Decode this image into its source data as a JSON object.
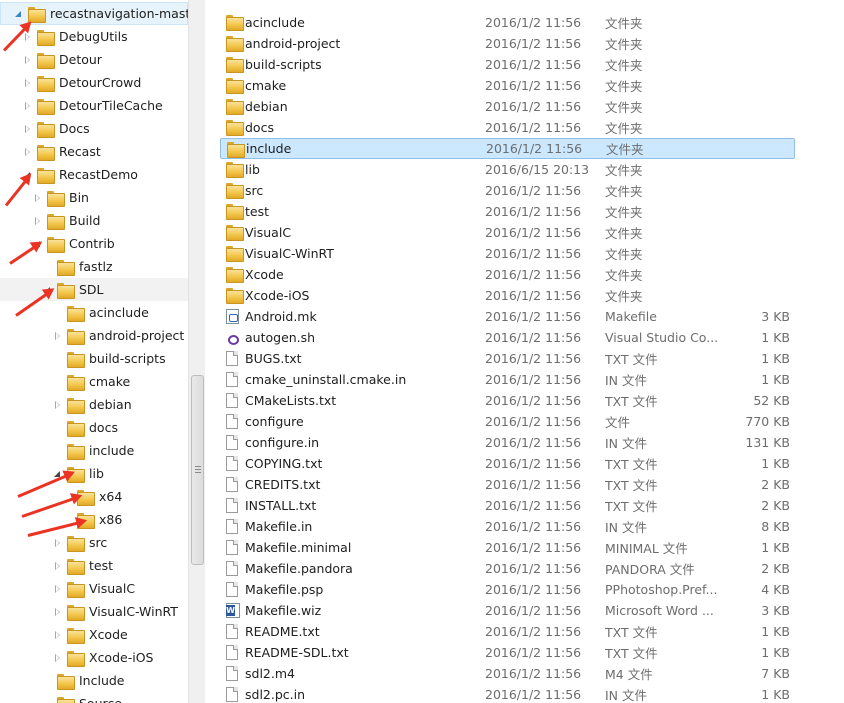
{
  "tree": {
    "items": [
      {
        "label": "recastnavigation-master",
        "depth": 0,
        "state": "expanded-light",
        "selected": true
      },
      {
        "label": "DebugUtils",
        "depth": 1,
        "state": "collapsed"
      },
      {
        "label": "Detour",
        "depth": 1,
        "state": "collapsed"
      },
      {
        "label": "DetourCrowd",
        "depth": 1,
        "state": "collapsed"
      },
      {
        "label": "DetourTileCache",
        "depth": 1,
        "state": "collapsed"
      },
      {
        "label": "Docs",
        "depth": 1,
        "state": "collapsed"
      },
      {
        "label": "Recast",
        "depth": 1,
        "state": "collapsed"
      },
      {
        "label": "RecastDemo",
        "depth": 1,
        "state": "expanded"
      },
      {
        "label": "Bin",
        "depth": 2,
        "state": "collapsed"
      },
      {
        "label": "Build",
        "depth": 2,
        "state": "collapsed"
      },
      {
        "label": "Contrib",
        "depth": 2,
        "state": "expanded"
      },
      {
        "label": "fastlz",
        "depth": 3,
        "state": "none"
      },
      {
        "label": "SDL",
        "depth": 3,
        "state": "expanded",
        "hover": true
      },
      {
        "label": "acinclude",
        "depth": 4,
        "state": "none"
      },
      {
        "label": "android-project",
        "depth": 4,
        "state": "collapsed"
      },
      {
        "label": "build-scripts",
        "depth": 4,
        "state": "none"
      },
      {
        "label": "cmake",
        "depth": 4,
        "state": "none"
      },
      {
        "label": "debian",
        "depth": 4,
        "state": "collapsed"
      },
      {
        "label": "docs",
        "depth": 4,
        "state": "none"
      },
      {
        "label": "include",
        "depth": 4,
        "state": "none"
      },
      {
        "label": "lib",
        "depth": 4,
        "state": "expanded"
      },
      {
        "label": "x64",
        "depth": 5,
        "state": "none"
      },
      {
        "label": "x86",
        "depth": 5,
        "state": "none"
      },
      {
        "label": "src",
        "depth": 4,
        "state": "collapsed"
      },
      {
        "label": "test",
        "depth": 4,
        "state": "collapsed"
      },
      {
        "label": "VisualC",
        "depth": 4,
        "state": "collapsed"
      },
      {
        "label": "VisualC-WinRT",
        "depth": 4,
        "state": "collapsed"
      },
      {
        "label": "Xcode",
        "depth": 4,
        "state": "collapsed"
      },
      {
        "label": "Xcode-iOS",
        "depth": 4,
        "state": "collapsed"
      },
      {
        "label": "Include",
        "depth": 3,
        "state": "none"
      },
      {
        "label": "Source",
        "depth": 3,
        "state": "none"
      }
    ]
  },
  "files": [
    {
      "name": "acinclude",
      "date": "2016/1/2 11:56",
      "type": "文件夹",
      "size": "",
      "icon": "folder-icon"
    },
    {
      "name": "android-project",
      "date": "2016/1/2 11:56",
      "type": "文件夹",
      "size": "",
      "icon": "folder-icon"
    },
    {
      "name": "build-scripts",
      "date": "2016/1/2 11:56",
      "type": "文件夹",
      "size": "",
      "icon": "folder-icon"
    },
    {
      "name": "cmake",
      "date": "2016/1/2 11:56",
      "type": "文件夹",
      "size": "",
      "icon": "folder-icon"
    },
    {
      "name": "debian",
      "date": "2016/1/2 11:56",
      "type": "文件夹",
      "size": "",
      "icon": "folder-icon"
    },
    {
      "name": "docs",
      "date": "2016/1/2 11:56",
      "type": "文件夹",
      "size": "",
      "icon": "folder-icon"
    },
    {
      "name": "include",
      "date": "2016/1/2 11:56",
      "type": "文件夹",
      "size": "",
      "icon": "folder-icon",
      "selected": true
    },
    {
      "name": "lib",
      "date": "2016/6/15 20:13",
      "type": "文件夹",
      "size": "",
      "icon": "folder-icon"
    },
    {
      "name": "src",
      "date": "2016/1/2 11:56",
      "type": "文件夹",
      "size": "",
      "icon": "folder-icon"
    },
    {
      "name": "test",
      "date": "2016/1/2 11:56",
      "type": "文件夹",
      "size": "",
      "icon": "folder-icon"
    },
    {
      "name": "VisualC",
      "date": "2016/1/2 11:56",
      "type": "文件夹",
      "size": "",
      "icon": "folder-icon"
    },
    {
      "name": "VisualC-WinRT",
      "date": "2016/1/2 11:56",
      "type": "文件夹",
      "size": "",
      "icon": "folder-icon"
    },
    {
      "name": "Xcode",
      "date": "2016/1/2 11:56",
      "type": "文件夹",
      "size": "",
      "icon": "folder-icon"
    },
    {
      "name": "Xcode-iOS",
      "date": "2016/1/2 11:56",
      "type": "文件夹",
      "size": "",
      "icon": "folder-icon"
    },
    {
      "name": "Android.mk",
      "date": "2016/1/2 11:56",
      "type": "Makefile",
      "size": "3 KB",
      "icon": "makefile-icon"
    },
    {
      "name": "autogen.sh",
      "date": "2016/1/2 11:56",
      "type": "Visual Studio Co...",
      "size": "1 KB",
      "icon": "visual-studio-icon"
    },
    {
      "name": "BUGS.txt",
      "date": "2016/1/2 11:56",
      "type": "TXT 文件",
      "size": "1 KB",
      "icon": "document-icon"
    },
    {
      "name": "cmake_uninstall.cmake.in",
      "date": "2016/1/2 11:56",
      "type": "IN 文件",
      "size": "1 KB",
      "icon": "document-icon"
    },
    {
      "name": "CMakeLists.txt",
      "date": "2016/1/2 11:56",
      "type": "TXT 文件",
      "size": "52 KB",
      "icon": "document-icon"
    },
    {
      "name": "configure",
      "date": "2016/1/2 11:56",
      "type": "文件",
      "size": "770 KB",
      "icon": "document-icon"
    },
    {
      "name": "configure.in",
      "date": "2016/1/2 11:56",
      "type": "IN 文件",
      "size": "131 KB",
      "icon": "document-icon"
    },
    {
      "name": "COPYING.txt",
      "date": "2016/1/2 11:56",
      "type": "TXT 文件",
      "size": "1 KB",
      "icon": "document-icon"
    },
    {
      "name": "CREDITS.txt",
      "date": "2016/1/2 11:56",
      "type": "TXT 文件",
      "size": "2 KB",
      "icon": "document-icon"
    },
    {
      "name": "INSTALL.txt",
      "date": "2016/1/2 11:56",
      "type": "TXT 文件",
      "size": "2 KB",
      "icon": "document-icon"
    },
    {
      "name": "Makefile.in",
      "date": "2016/1/2 11:56",
      "type": "IN 文件",
      "size": "8 KB",
      "icon": "document-icon"
    },
    {
      "name": "Makefile.minimal",
      "date": "2016/1/2 11:56",
      "type": "MINIMAL 文件",
      "size": "1 KB",
      "icon": "document-icon"
    },
    {
      "name": "Makefile.pandora",
      "date": "2016/1/2 11:56",
      "type": "PANDORA 文件",
      "size": "2 KB",
      "icon": "document-icon"
    },
    {
      "name": "Makefile.psp",
      "date": "2016/1/2 11:56",
      "type": "PPhotoshop.Pref...",
      "size": "4 KB",
      "icon": "document-icon"
    },
    {
      "name": "Makefile.wiz",
      "date": "2016/1/2 11:56",
      "type": "Microsoft Word ...",
      "size": "3 KB",
      "icon": "word-icon"
    },
    {
      "name": "README.txt",
      "date": "2016/1/2 11:56",
      "type": "TXT 文件",
      "size": "1 KB",
      "icon": "document-icon"
    },
    {
      "name": "README-SDL.txt",
      "date": "2016/1/2 11:56",
      "type": "TXT 文件",
      "size": "1 KB",
      "icon": "document-icon"
    },
    {
      "name": "sdl2.m4",
      "date": "2016/1/2 11:56",
      "type": "M4 文件",
      "size": "7 KB",
      "icon": "document-icon"
    },
    {
      "name": "sdl2.pc.in",
      "date": "2016/1/2 11:56",
      "type": "IN 文件",
      "size": "1 KB",
      "icon": "document-icon"
    }
  ],
  "colors": {
    "selection": "#cce8ff",
    "selection_border": "#8fbfe6",
    "annotation_arrow": "#ea3323",
    "secondary_text": "#6d6d6d"
  }
}
